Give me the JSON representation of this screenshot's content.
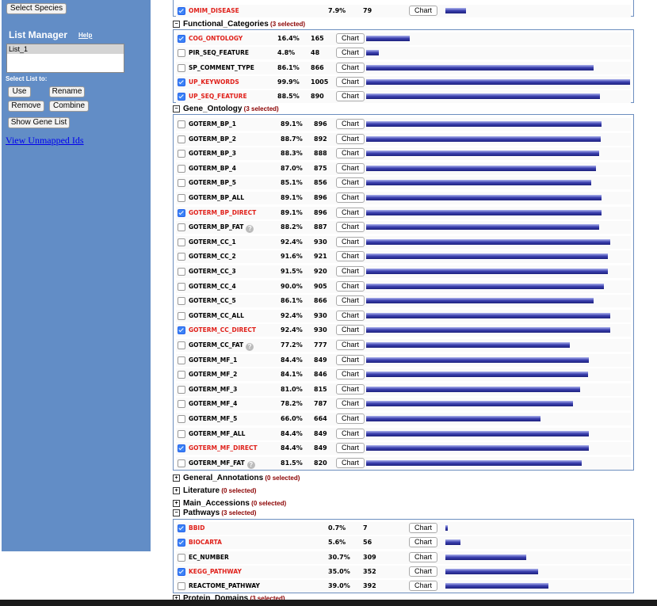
{
  "sidebar": {
    "select_species_label": "Select Species",
    "list_manager_title": "List Manager",
    "help_link": "Help",
    "lists": [
      "List_1"
    ],
    "select_list_label": "Select List to:",
    "use_label": "Use",
    "rename_label": "Rename",
    "remove_label": "Remove",
    "combine_label": "Combine",
    "show_gene_list_label": "Show Gene List",
    "view_unmapped_label": "View Unmapped Ids"
  },
  "chart_button_label": "Chart",
  "help_glyph": "?",
  "max_count": 1005,
  "sections": {
    "top": {
      "rows": [
        {
          "name": "OMIM_DISEASE",
          "checked": true,
          "percent": "7.9%",
          "count": 79
        }
      ]
    },
    "functional": {
      "title": "Functional_Categories",
      "selected": "(3 selected)",
      "rows": [
        {
          "name": "COG_ONTOLOGY",
          "checked": true,
          "percent": "16.4%",
          "count": 165
        },
        {
          "name": "PIR_SEQ_FEATURE",
          "checked": false,
          "percent": "4.8%",
          "count": 48
        },
        {
          "name": "SP_COMMENT_TYPE",
          "checked": false,
          "percent": "86.1%",
          "count": 866
        },
        {
          "name": "UP_KEYWORDS",
          "checked": true,
          "percent": "99.9%",
          "count": 1005
        },
        {
          "name": "UP_SEQ_FEATURE",
          "checked": true,
          "percent": "88.5%",
          "count": 890
        }
      ]
    },
    "gene_ontology": {
      "title": "Gene_Ontology",
      "selected": "(3 selected)",
      "rows": [
        {
          "name": "GOTERM_BP_1",
          "checked": false,
          "percent": "89.1%",
          "count": 896
        },
        {
          "name": "GOTERM_BP_2",
          "checked": false,
          "percent": "88.7%",
          "count": 892
        },
        {
          "name": "GOTERM_BP_3",
          "checked": false,
          "percent": "88.3%",
          "count": 888
        },
        {
          "name": "GOTERM_BP_4",
          "checked": false,
          "percent": "87.0%",
          "count": 875
        },
        {
          "name": "GOTERM_BP_5",
          "checked": false,
          "percent": "85.1%",
          "count": 856
        },
        {
          "name": "GOTERM_BP_ALL",
          "checked": false,
          "percent": "89.1%",
          "count": 896
        },
        {
          "name": "GOTERM_BP_DIRECT",
          "checked": true,
          "percent": "89.1%",
          "count": 896
        },
        {
          "name": "GOTERM_BP_FAT",
          "checked": false,
          "percent": "88.2%",
          "count": 887,
          "help": true
        },
        {
          "name": "GOTERM_CC_1",
          "checked": false,
          "percent": "92.4%",
          "count": 930
        },
        {
          "name": "GOTERM_CC_2",
          "checked": false,
          "percent": "91.6%",
          "count": 921
        },
        {
          "name": "GOTERM_CC_3",
          "checked": false,
          "percent": "91.5%",
          "count": 920
        },
        {
          "name": "GOTERM_CC_4",
          "checked": false,
          "percent": "90.0%",
          "count": 905
        },
        {
          "name": "GOTERM_CC_5",
          "checked": false,
          "percent": "86.1%",
          "count": 866
        },
        {
          "name": "GOTERM_CC_ALL",
          "checked": false,
          "percent": "92.4%",
          "count": 930
        },
        {
          "name": "GOTERM_CC_DIRECT",
          "checked": true,
          "percent": "92.4%",
          "count": 930
        },
        {
          "name": "GOTERM_CC_FAT",
          "checked": false,
          "percent": "77.2%",
          "count": 777,
          "help": true
        },
        {
          "name": "GOTERM_MF_1",
          "checked": false,
          "percent": "84.4%",
          "count": 849
        },
        {
          "name": "GOTERM_MF_2",
          "checked": false,
          "percent": "84.1%",
          "count": 846
        },
        {
          "name": "GOTERM_MF_3",
          "checked": false,
          "percent": "81.0%",
          "count": 815
        },
        {
          "name": "GOTERM_MF_4",
          "checked": false,
          "percent": "78.2%",
          "count": 787
        },
        {
          "name": "GOTERM_MF_5",
          "checked": false,
          "percent": "66.0%",
          "count": 664
        },
        {
          "name": "GOTERM_MF_ALL",
          "checked": false,
          "percent": "84.4%",
          "count": 849
        },
        {
          "name": "GOTERM_MF_DIRECT",
          "checked": true,
          "percent": "84.4%",
          "count": 849
        },
        {
          "name": "GOTERM_MF_FAT",
          "checked": false,
          "percent": "81.5%",
          "count": 820,
          "help": true
        }
      ]
    },
    "general_annotations": {
      "title": "General_Annotations",
      "selected": "(0 selected)"
    },
    "literature": {
      "title": "Literature",
      "selected": "(0 selected)"
    },
    "main_accessions": {
      "title": "Main_Accessions",
      "selected": "(0 selected)"
    },
    "pathways": {
      "title": "Pathways",
      "selected": "(3 selected)",
      "rows": [
        {
          "name": "BBID",
          "checked": true,
          "percent": "0.7%",
          "count": 7
        },
        {
          "name": "BIOCARTA",
          "checked": true,
          "percent": "5.6%",
          "count": 56
        },
        {
          "name": "EC_NUMBER",
          "checked": false,
          "percent": "30.7%",
          "count": 309
        },
        {
          "name": "KEGG_PATHWAY",
          "checked": true,
          "percent": "35.0%",
          "count": 352
        },
        {
          "name": "REACTOME_PATHWAY",
          "checked": false,
          "percent": "39.0%",
          "count": 392
        }
      ]
    },
    "protein_domains": {
      "title": "Protein_Domains",
      "selected": "(3 selected)"
    }
  }
}
